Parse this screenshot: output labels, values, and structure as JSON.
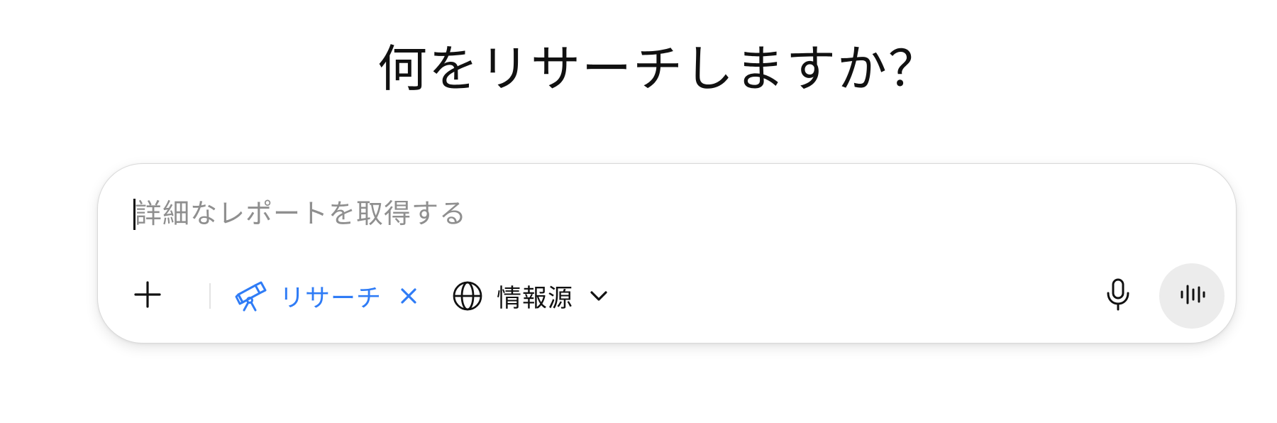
{
  "heading": "何をリサーチしますか？",
  "composer": {
    "placeholder": "詳細なレポートを取得する",
    "value": ""
  },
  "toolbar": {
    "add_icon": "plus-icon",
    "research_chip": {
      "label": "リサーチ",
      "icon": "telescope-icon",
      "close_icon": "close-icon",
      "color": "#2f7cf6"
    },
    "sources": {
      "label": "情報源",
      "icon": "globe-icon",
      "chevron_icon": "chevron-down-icon"
    },
    "mic_icon": "microphone-icon",
    "voice_icon": "voice-waveform-icon"
  }
}
